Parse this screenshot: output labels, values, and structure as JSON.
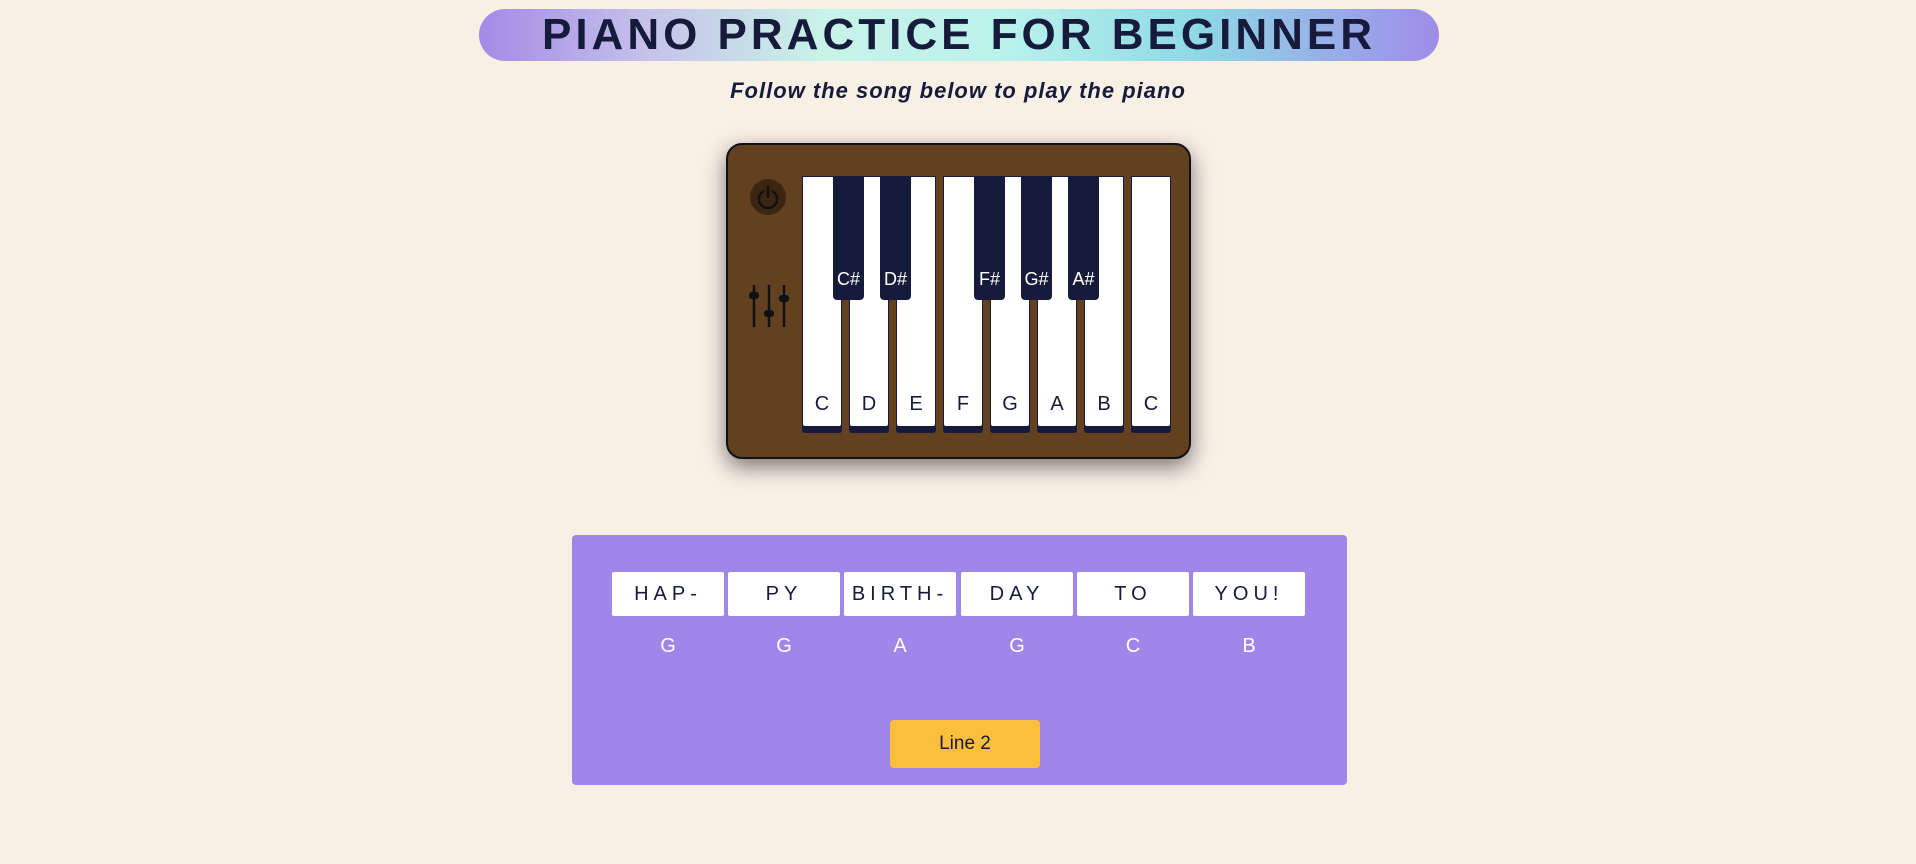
{
  "header": {
    "title": "PIANO PRACTICE FOR BEGINNER",
    "subtitle": "Follow the song below to play the piano"
  },
  "piano": {
    "controls": {
      "power_icon": "power-icon",
      "sliders_icon": "sliders-icon"
    },
    "white_keys": [
      "C",
      "D",
      "E",
      "F",
      "G",
      "A",
      "B",
      "C"
    ],
    "black_keys": [
      "C#",
      "D#",
      "F#",
      "G#",
      "A#"
    ]
  },
  "song": {
    "lyrics": [
      "HAP-",
      "PY",
      "BIRTH-",
      "DAY",
      "TO",
      "YOU!"
    ],
    "notes": [
      "G",
      "G",
      "A",
      "G",
      "C",
      "B"
    ],
    "next_button_label": "Line 2"
  },
  "colors": {
    "background": "#f8efe5",
    "navy": "#161b3b",
    "piano_body": "#634020",
    "song_panel": "#a086e9",
    "button": "#fbbf3c"
  }
}
